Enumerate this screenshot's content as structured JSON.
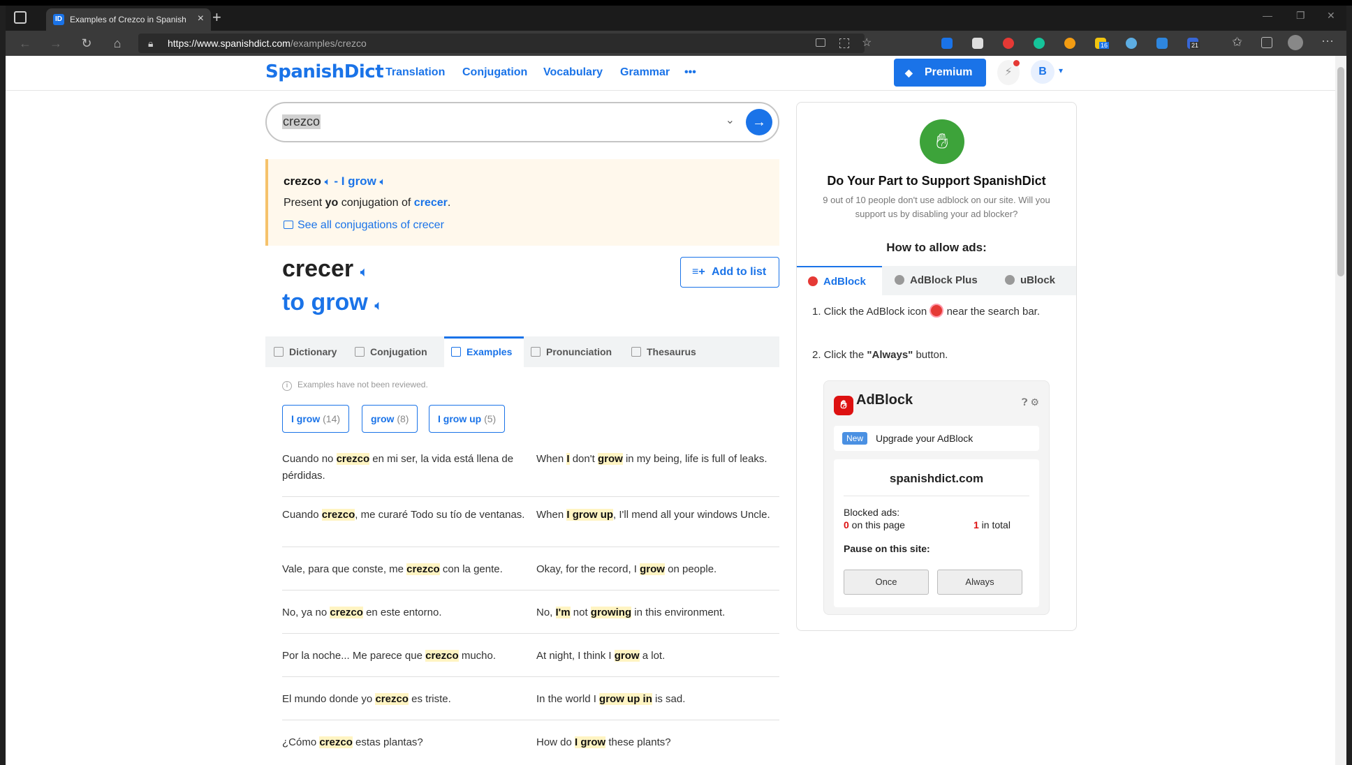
{
  "browser": {
    "tab_title": "Examples of Crezco in Spanish | S",
    "tab_close": "×",
    "new_tab": "+",
    "url_host": "https://www.spanishdict.com",
    "url_path": "/examples/crezco",
    "window_controls": [
      "—",
      "❐",
      "✕"
    ],
    "ext_badges": [
      "16",
      "21"
    ]
  },
  "header": {
    "logo": "SpanishDict",
    "nav": [
      "Translation",
      "Conjugation",
      "Vocabulary",
      "Grammar",
      "•••"
    ],
    "premium_label": "Premium",
    "avatar_letter": "B"
  },
  "search": {
    "value": "crezco"
  },
  "conj_card": {
    "word": "crezco",
    "dash": " - ",
    "translation": "I grow",
    "line2_pre": "Present ",
    "line2_bold": "yo",
    "line2_mid": " conjugation of ",
    "line2_link": "crecer",
    "line2_end": ".",
    "see_all": "See all conjugations of crecer"
  },
  "headword": {
    "word": "crecer",
    "translation": "to grow",
    "add_to_list": "Add to list"
  },
  "page_tabs": [
    "Dictionary",
    "Conjugation",
    "Examples",
    "Pronunciation",
    "Thesaurus"
  ],
  "examples": {
    "notice": "Examples have not been reviewed.",
    "chips": [
      {
        "label": "I grow",
        "count": "(14)"
      },
      {
        "label": "grow",
        "count": "(8)"
      },
      {
        "label": "I grow up",
        "count": "(5)"
      }
    ],
    "rows": [
      {
        "es": [
          "Cuando no ",
          "crezco",
          " en mi ser, la vida está llena de pérdidas."
        ],
        "en": [
          "When ",
          "I",
          " don't ",
          "grow",
          " in my being, life is full of leaks."
        ]
      },
      {
        "es": [
          "Cuando ",
          "crezco",
          ", me curaré Todo su tío de ventanas."
        ],
        "en": [
          "When ",
          "I grow up",
          ", I'll mend all your windows Uncle."
        ]
      },
      {
        "es": [
          "Vale, para que conste, me ",
          "crezco",
          " con la gente."
        ],
        "en": [
          "Okay, for the record, I ",
          "grow",
          " on people."
        ]
      },
      {
        "es": [
          "No, ya no ",
          "crezco",
          " en este entorno."
        ],
        "en": [
          "No, ",
          "I'm",
          " not ",
          "growing",
          " in this environment."
        ]
      },
      {
        "es": [
          "Por la noche... Me parece que ",
          "crezco",
          " mucho."
        ],
        "en": [
          "At night, I think I ",
          "grow",
          " a lot."
        ]
      },
      {
        "es": [
          "El mundo donde yo ",
          "crezco",
          " es triste."
        ],
        "en": [
          "In the world I ",
          "grow up in",
          " is sad."
        ]
      },
      {
        "es": [
          "¿Cómo ",
          "crezco",
          " estas plantas?"
        ],
        "en": [
          "How do ",
          "I grow",
          " these plants?"
        ]
      }
    ]
  },
  "sidebar": {
    "title": "Do Your Part to Support SpanishDict",
    "desc": "9 out of 10 people don't use adblock on our site. Will you support us by disabling your ad blocker?",
    "how": "How to allow ads:",
    "tabs": [
      "AdBlock",
      "AdBlock Plus",
      "uBlock"
    ],
    "step1_pre": "1. Click the AdBlock icon",
    "step1_post": "near the search bar.",
    "step2_pre": "2. Click the ",
    "step2_bold": "\"Always\"",
    "step2_post": " button.",
    "panel": {
      "brand": "AdBlock",
      "new_badge": "New",
      "upgrade": "Upgrade your AdBlock",
      "domain": "spanishdict.com",
      "blocked_label": "Blocked ads:",
      "on_page_num": "0",
      "on_page_text": " on this page",
      "total_num": "1",
      "total_text": " in total",
      "pause_label": "Pause on this site:",
      "once": "Once",
      "always": "Always"
    }
  },
  "colors": {
    "brand_blue": "#1a73e8",
    "highlight": "#fff4c2",
    "card_bg": "#fff8ec",
    "adblock_green": "#3da33a"
  }
}
